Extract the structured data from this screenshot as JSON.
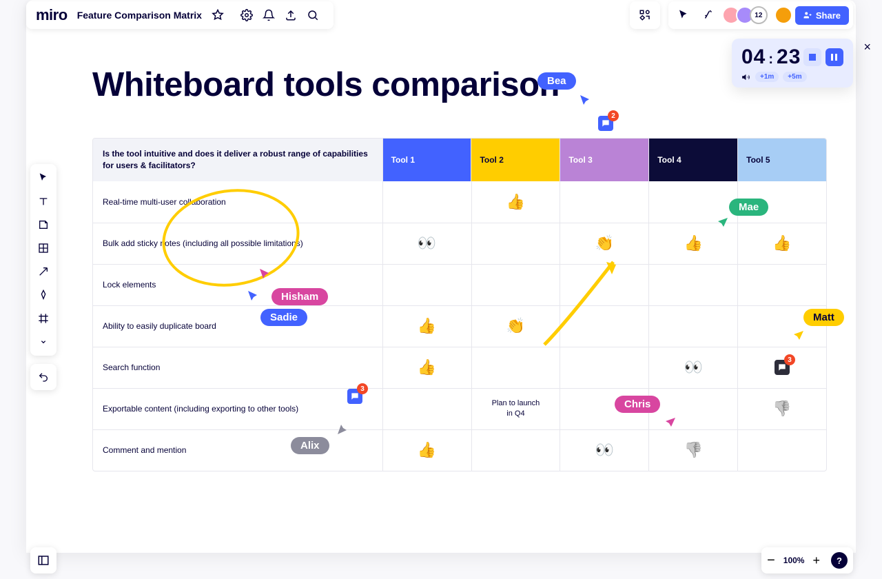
{
  "header": {
    "logo": "miro",
    "board_name": "Feature Comparison Matrix",
    "share_label": "Share",
    "avatar_overflow": "12"
  },
  "timer": {
    "minutes": "04",
    "seconds": "23",
    "plus1": "+1m",
    "plus5": "+5m"
  },
  "canvas": {
    "title": "Whiteboard tools comparison"
  },
  "table": {
    "question": "Is the tool intuitive and does it deliver a robust range of capabilities for users & facilitators?",
    "tools": [
      "Tool 1",
      "Tool 2",
      "Tool 3",
      "Tool 4",
      "Tool 5"
    ],
    "rows": [
      {
        "label": "Real-time multi-user collaboration",
        "cells": [
          "",
          "thumb",
          "",
          "",
          ""
        ]
      },
      {
        "label": "Bulk add sticky notes (including all possible limitations)",
        "cells": [
          "eyes",
          "",
          "clap",
          "thumb",
          "thumb"
        ]
      },
      {
        "label": "Lock elements",
        "cells": [
          "",
          "",
          "",
          "",
          ""
        ]
      },
      {
        "label": "Ability to easily duplicate board",
        "cells": [
          "thumb",
          "clap",
          "",
          "",
          ""
        ]
      },
      {
        "label": "Search function",
        "cells": [
          "thumb",
          "",
          "",
          "eyes",
          "comment3"
        ]
      },
      {
        "label": "Exportable content (including exporting to other tools)",
        "cells": [
          "",
          "Plan to launch in Q4",
          "",
          "",
          "thumbdown"
        ]
      },
      {
        "label": "Comment and mention",
        "cells": [
          "thumb",
          "",
          "eyes",
          "thumbdown",
          ""
        ]
      }
    ]
  },
  "cursors": {
    "bea": "Bea",
    "mae": "Mae",
    "hisham": "Hisham",
    "sadie": "Sadie",
    "matt": "Matt",
    "chris": "Chris",
    "alix": "Alix"
  },
  "comments": {
    "top_badge": "2",
    "mid_badge": "3",
    "right_badge": "3"
  },
  "zoom": {
    "level": "100%"
  }
}
